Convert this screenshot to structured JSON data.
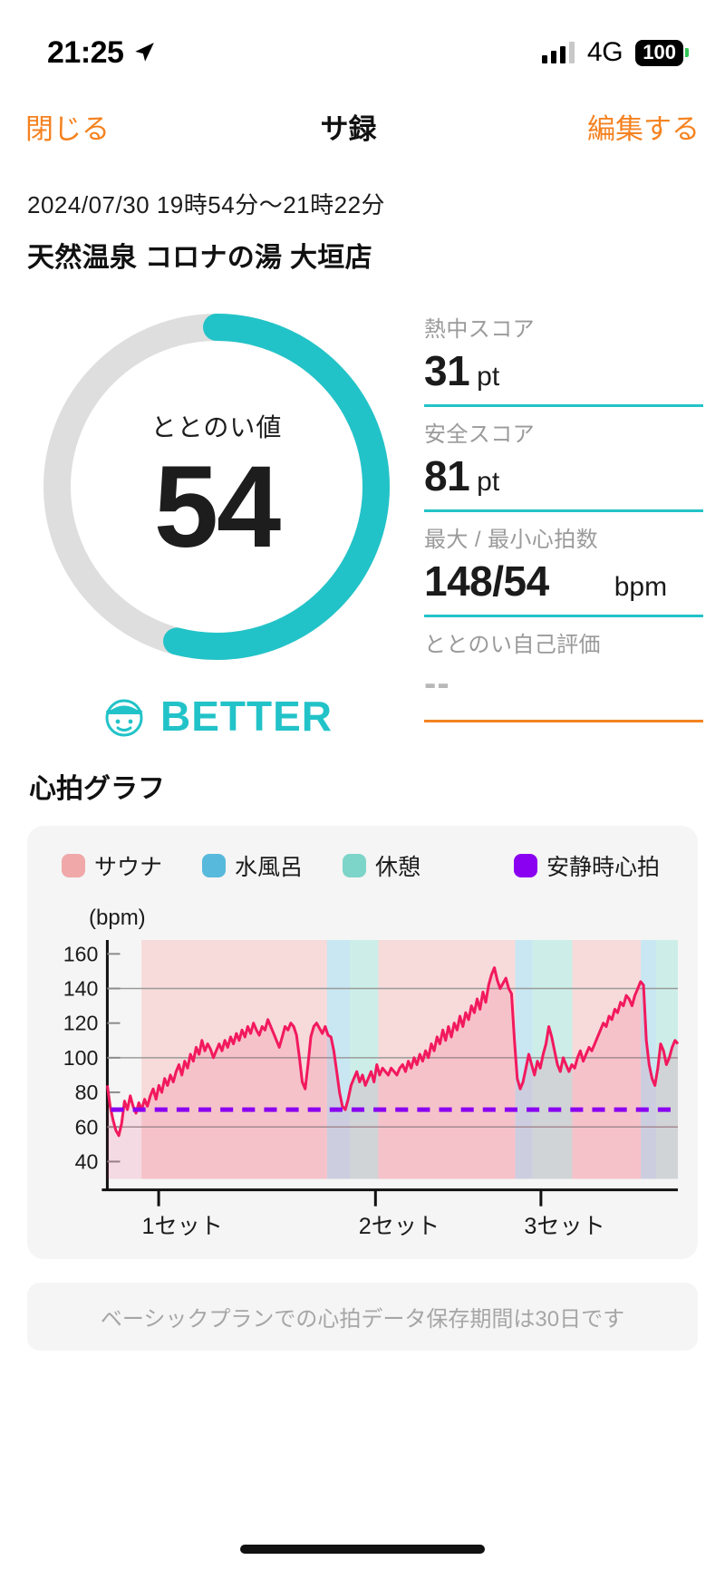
{
  "status_bar": {
    "time": "21:25",
    "network": "4G",
    "battery": "100",
    "location_icon": "location-arrow-icon",
    "signal_icon": "cellular-bars-icon"
  },
  "nav": {
    "close_label": "閉じる",
    "title": "サ録",
    "edit_label": "編集する",
    "accent_color": "#f58220"
  },
  "session": {
    "date_range": "2024/07/30 19時54分〜21時22分",
    "venue": "天然温泉 コロナの湯 大垣店"
  },
  "totonoi": {
    "label": "ととのい値",
    "value": "54",
    "percent": 54,
    "rating_label": "BETTER",
    "ring_color": "#22c3c8",
    "track_color": "#dedede"
  },
  "stats": [
    {
      "label": "熱中スコア",
      "value": "31",
      "unit": "pt",
      "rule_color": "#22c3c8"
    },
    {
      "label": "安全スコア",
      "value": "81",
      "unit": "pt",
      "rule_color": "#22c3c8"
    },
    {
      "label": "最大 / 最小心拍数",
      "value": "148/54",
      "unit": "bpm",
      "rule_color": "#22c3c8"
    },
    {
      "label": "ととのい自己評価",
      "value": "--",
      "unit": "",
      "rule_color": "#f58220"
    }
  ],
  "chart_section": {
    "title": "心拍グラフ",
    "note": "ベーシックプランでの心拍データ保存期間は30日です"
  },
  "chart_data": {
    "type": "line",
    "title": "心拍グラフ",
    "ylabel": "(bpm)",
    "xlabel": "",
    "ylim": [
      30,
      168
    ],
    "yticks": [
      40,
      60,
      80,
      100,
      120,
      140,
      160
    ],
    "gridlines": [
      60,
      100,
      140
    ],
    "grid": true,
    "legend_position": "top",
    "legend": [
      {
        "name": "サウナ",
        "color": "#f0a8a8"
      },
      {
        "name": "水風呂",
        "color": "#57b9db"
      },
      {
        "name": "休憩",
        "color": "#7dd4c8"
      },
      {
        "name": "安静時心拍",
        "color": "#8a00f0"
      }
    ],
    "resting_hr": 70,
    "xticks": [
      "1セット",
      "2セット",
      "3セット"
    ],
    "xtick_positions": [
      0.09,
      0.47,
      0.76
    ],
    "bands": [
      {
        "type": "サウナ",
        "x0": 0.06,
        "x1": 0.385,
        "color": "#f7d5d5"
      },
      {
        "type": "水風呂",
        "x0": 0.385,
        "x1": 0.425,
        "color": "#bfe4f2"
      },
      {
        "type": "休憩",
        "x0": 0.425,
        "x1": 0.475,
        "color": "#c6ece5"
      },
      {
        "type": "サウナ",
        "x0": 0.475,
        "x1": 0.715,
        "color": "#f7d5d5"
      },
      {
        "type": "水風呂",
        "x0": 0.715,
        "x1": 0.745,
        "color": "#bfe4f2"
      },
      {
        "type": "休憩",
        "x0": 0.745,
        "x1": 0.815,
        "color": "#c6ece5"
      },
      {
        "type": "サウナ",
        "x0": 0.815,
        "x1": 0.935,
        "color": "#f7d5d5"
      },
      {
        "type": "水風呂",
        "x0": 0.935,
        "x1": 0.962,
        "color": "#bfe4f2"
      },
      {
        "type": "休憩",
        "x0": 0.962,
        "x1": 1.0,
        "color": "#c6ece5"
      }
    ],
    "series": [
      {
        "name": "心拍数",
        "color": "#f2195e",
        "values": [
          84,
          72,
          64,
          58,
          55,
          62,
          75,
          70,
          78,
          72,
          68,
          74,
          70,
          76,
          72,
          78,
          82,
          76,
          84,
          80,
          88,
          84,
          90,
          86,
          92,
          96,
          90,
          98,
          94,
          102,
          98,
          106,
          102,
          110,
          104,
          108,
          105,
          100,
          104,
          108,
          104,
          110,
          106,
          112,
          108,
          114,
          110,
          116,
          112,
          118,
          114,
          120,
          116,
          113,
          118,
          116,
          122,
          118,
          114,
          110,
          106,
          112,
          118,
          116,
          120,
          118,
          113,
          100,
          86,
          82,
          96,
          112,
          118,
          120,
          117,
          114,
          118,
          113,
          112,
          104,
          92,
          80,
          72,
          70,
          76,
          84,
          88,
          92,
          86,
          90,
          84,
          88,
          92,
          86,
          96,
          90,
          94,
          92,
          90,
          94,
          92,
          90,
          94,
          96,
          92,
          98,
          94,
          100,
          96,
          102,
          98,
          104,
          100,
          108,
          104,
          112,
          108,
          116,
          110,
          118,
          112,
          120,
          116,
          124,
          118,
          126,
          122,
          130,
          126,
          134,
          128,
          138,
          132,
          142,
          148,
          152,
          145,
          140,
          143,
          146,
          140,
          137,
          110,
          88,
          82,
          86,
          94,
          102,
          96,
          90,
          98,
          94,
          102,
          108,
          118,
          112,
          104,
          96,
          92,
          100,
          96,
          92,
          96,
          94,
          100,
          104,
          98,
          102,
          106,
          104,
          108,
          112,
          116,
          120,
          118,
          124,
          122,
          128,
          126,
          132,
          130,
          136,
          134,
          130,
          136,
          140,
          144,
          142,
          110,
          96,
          88,
          84,
          94,
          108,
          104,
          96,
          100,
          106,
          110,
          108
        ]
      }
    ]
  }
}
